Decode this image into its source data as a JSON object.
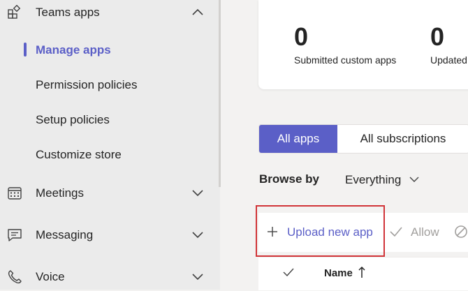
{
  "sidebar": {
    "teams_apps": {
      "label": "Teams apps",
      "icon": "apps-icon"
    },
    "sub_items": [
      {
        "label": "Manage apps",
        "active": true
      },
      {
        "label": "Permission policies",
        "active": false
      },
      {
        "label": "Setup policies",
        "active": false
      },
      {
        "label": "Customize store",
        "active": false
      }
    ],
    "meetings": {
      "label": "Meetings",
      "icon": "calendar-icon"
    },
    "messaging": {
      "label": "Messaging",
      "icon": "chat-icon"
    },
    "voice": {
      "label": "Voice",
      "icon": "phone-icon"
    }
  },
  "stats": {
    "submitted": {
      "value": "0",
      "label": "Submitted custom apps"
    },
    "updated": {
      "value": "0",
      "label": "Updated"
    }
  },
  "tabs": {
    "all_apps": "All apps",
    "all_subscriptions": "All subscriptions"
  },
  "browse": {
    "label": "Browse by",
    "selected": "Everything"
  },
  "toolbar": {
    "upload_label": "Upload new app",
    "allow_label": "Allow"
  },
  "table": {
    "name_header": "Name"
  },
  "colors": {
    "accent": "#5b5fc7",
    "highlight": "#d13438",
    "disabled": "#a19f9d"
  }
}
